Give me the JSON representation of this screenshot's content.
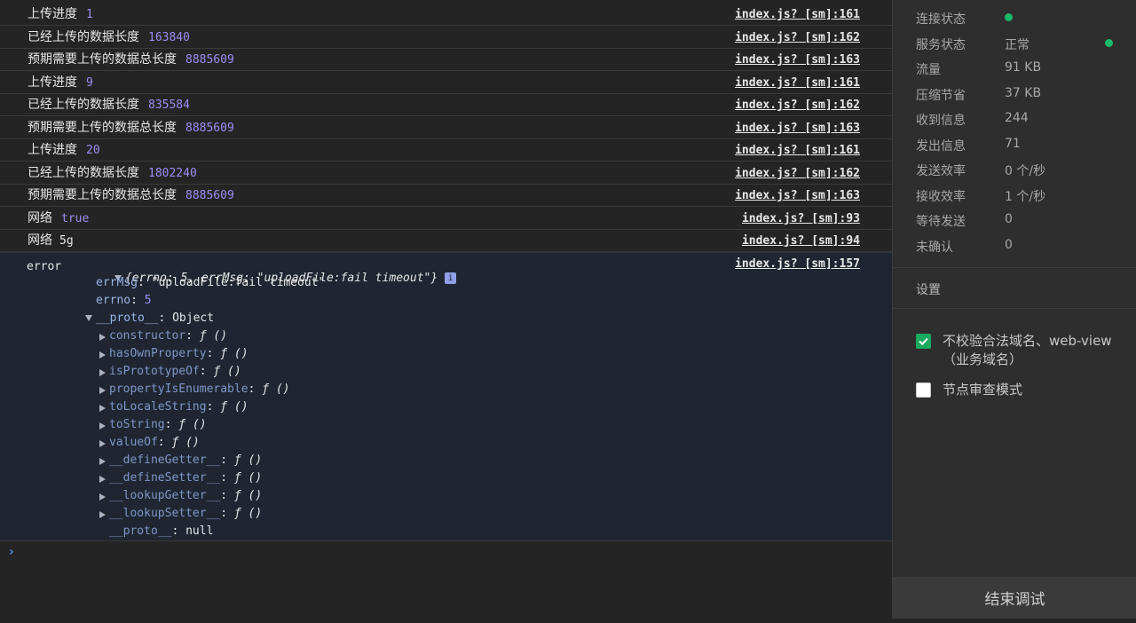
{
  "console": {
    "logs": [
      {
        "message": "上传进度",
        "value": "1",
        "value_type": "number",
        "source": "index.js? [sm]:161"
      },
      {
        "message": "已经上传的数据长度",
        "value": "163840",
        "value_type": "number",
        "source": "index.js? [sm]:162"
      },
      {
        "message": "预期需要上传的数据总长度",
        "value": "8885609",
        "value_type": "number",
        "source": "index.js? [sm]:163"
      },
      {
        "message": "上传进度",
        "value": "9",
        "value_type": "number",
        "source": "index.js? [sm]:161"
      },
      {
        "message": "已经上传的数据长度",
        "value": "835584",
        "value_type": "number",
        "source": "index.js? [sm]:162"
      },
      {
        "message": "预期需要上传的数据总长度",
        "value": "8885609",
        "value_type": "number",
        "source": "index.js? [sm]:163"
      },
      {
        "message": "上传进度",
        "value": "20",
        "value_type": "number",
        "source": "index.js? [sm]:161"
      },
      {
        "message": "已经上传的数据长度",
        "value": "1802240",
        "value_type": "number",
        "source": "index.js? [sm]:162"
      },
      {
        "message": "预期需要上传的数据总长度",
        "value": "8885609",
        "value_type": "number",
        "source": "index.js? [sm]:163"
      },
      {
        "message": "网络",
        "value": "true",
        "value_type": "boolean",
        "source": "index.js? [sm]:93"
      },
      {
        "message": "网络",
        "value": "5g",
        "value_type": "string",
        "source": "index.js? [sm]:94"
      }
    ],
    "error": {
      "label": "error",
      "summary": "{errno: 5, errMsg: \"uploadFile:fail timeout\"}",
      "source": "index.js? [sm]:157",
      "info_icon": "i",
      "errMsg_key": "errMsg",
      "errMsg_value": "\"uploadFile:fail timeout\"",
      "errno_key": "errno",
      "errno_value": "5",
      "proto_key": "__proto__",
      "proto_value": "Object",
      "methods": [
        {
          "name": "constructor",
          "value": "ƒ ()"
        },
        {
          "name": "hasOwnProperty",
          "value": "ƒ ()"
        },
        {
          "name": "isPrototypeOf",
          "value": "ƒ ()"
        },
        {
          "name": "propertyIsEnumerable",
          "value": "ƒ ()"
        },
        {
          "name": "toLocaleString",
          "value": "ƒ ()"
        },
        {
          "name": "toString",
          "value": "ƒ ()"
        },
        {
          "name": "valueOf",
          "value": "ƒ ()"
        },
        {
          "name": "__defineGetter__",
          "value": "ƒ ()"
        },
        {
          "name": "__defineSetter__",
          "value": "ƒ ()"
        },
        {
          "name": "__lookupGetter__",
          "value": "ƒ ()"
        },
        {
          "name": "__lookupSetter__",
          "value": "ƒ ()"
        }
      ],
      "inner_proto_key": "__proto__",
      "inner_proto_value": "null"
    },
    "prompt": "›"
  },
  "sidebar": {
    "stats": [
      {
        "label": "连接状态",
        "value": "",
        "dot": true
      },
      {
        "label": "服务状态",
        "value": "正常",
        "dot_right": true
      },
      {
        "label": "流量",
        "value": "91 KB"
      },
      {
        "label": "压缩节省",
        "value": "37 KB"
      },
      {
        "label": "收到信息",
        "value": "244"
      },
      {
        "label": "发出信息",
        "value": "71"
      },
      {
        "label": "发送效率",
        "value": "0 个/秒"
      },
      {
        "label": "接收效率",
        "value": "1 个/秒"
      },
      {
        "label": "等待发送",
        "value": "0"
      },
      {
        "label": "未确认",
        "value": "0"
      }
    ],
    "status_color": "#1cb86a",
    "settings_title": "设置",
    "checkboxes": [
      {
        "label": "不校验合法域名、web-view（业务域名）",
        "checked": true
      },
      {
        "label": "节点审查模式",
        "checked": false
      }
    ],
    "end_debug_label": "结束调试"
  }
}
